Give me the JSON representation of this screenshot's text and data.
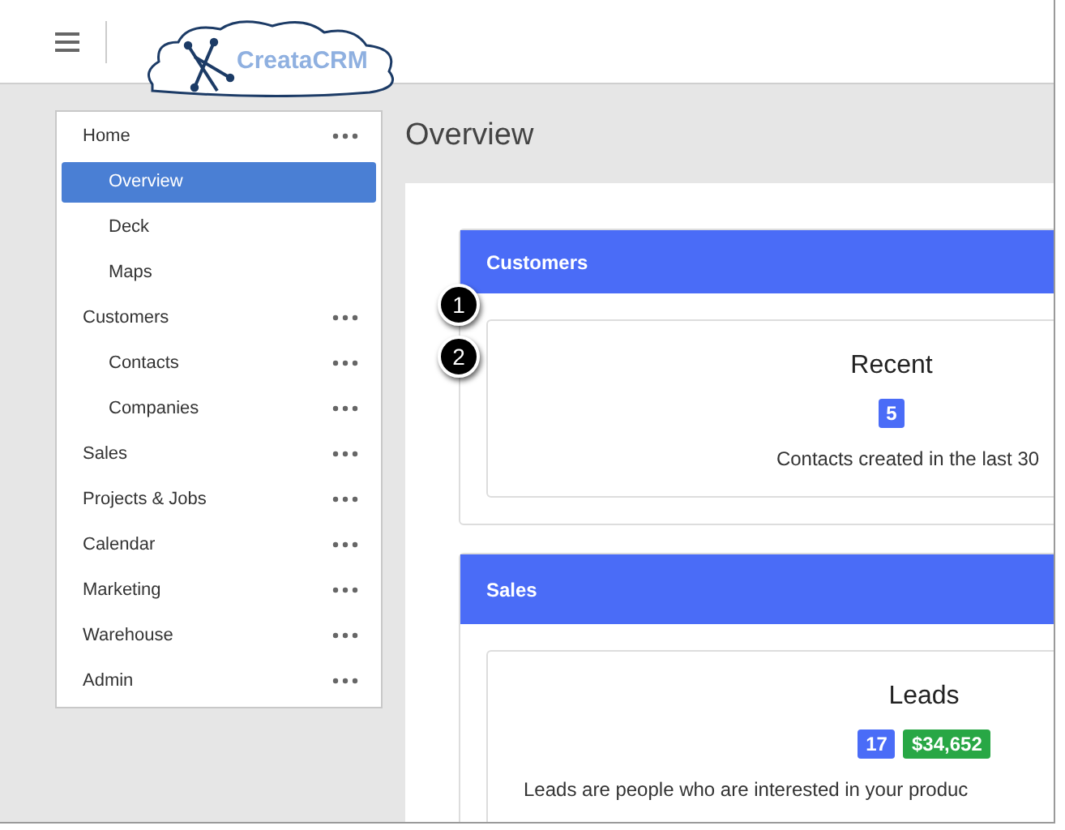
{
  "logo": {
    "text": "CreataCRM"
  },
  "nav": [
    {
      "label": "Home",
      "has_menu": true,
      "selected": false,
      "children": [
        {
          "label": "Overview",
          "has_menu": false,
          "selected": true
        },
        {
          "label": "Deck",
          "has_menu": false,
          "selected": false
        },
        {
          "label": "Maps",
          "has_menu": false,
          "selected": false
        }
      ]
    },
    {
      "label": "Customers",
      "has_menu": true,
      "selected": false,
      "children": [
        {
          "label": "Contacts",
          "has_menu": true,
          "selected": false
        },
        {
          "label": "Companies",
          "has_menu": true,
          "selected": false
        }
      ]
    },
    {
      "label": "Sales",
      "has_menu": true,
      "selected": false
    },
    {
      "label": "Projects & Jobs",
      "has_menu": true,
      "selected": false
    },
    {
      "label": "Calendar",
      "has_menu": true,
      "selected": false
    },
    {
      "label": "Marketing",
      "has_menu": true,
      "selected": false
    },
    {
      "label": "Warehouse",
      "has_menu": true,
      "selected": false
    },
    {
      "label": "Admin",
      "has_menu": true,
      "selected": false
    }
  ],
  "page_title": "Overview",
  "panels": [
    {
      "title": "Customers",
      "card": {
        "title": "Recent",
        "badges": [
          {
            "text": "5",
            "color": "#4a6cf7"
          }
        ],
        "description": "Contacts created in the last 30"
      }
    },
    {
      "title": "Sales",
      "card": {
        "title": "Leads",
        "badges": [
          {
            "text": "17",
            "color": "#4a6cf7"
          },
          {
            "text": "$34,652",
            "color": "#28a745"
          }
        ],
        "description": "Leads are people who are interested in your produc"
      }
    }
  ],
  "callouts": [
    "1",
    "2"
  ]
}
